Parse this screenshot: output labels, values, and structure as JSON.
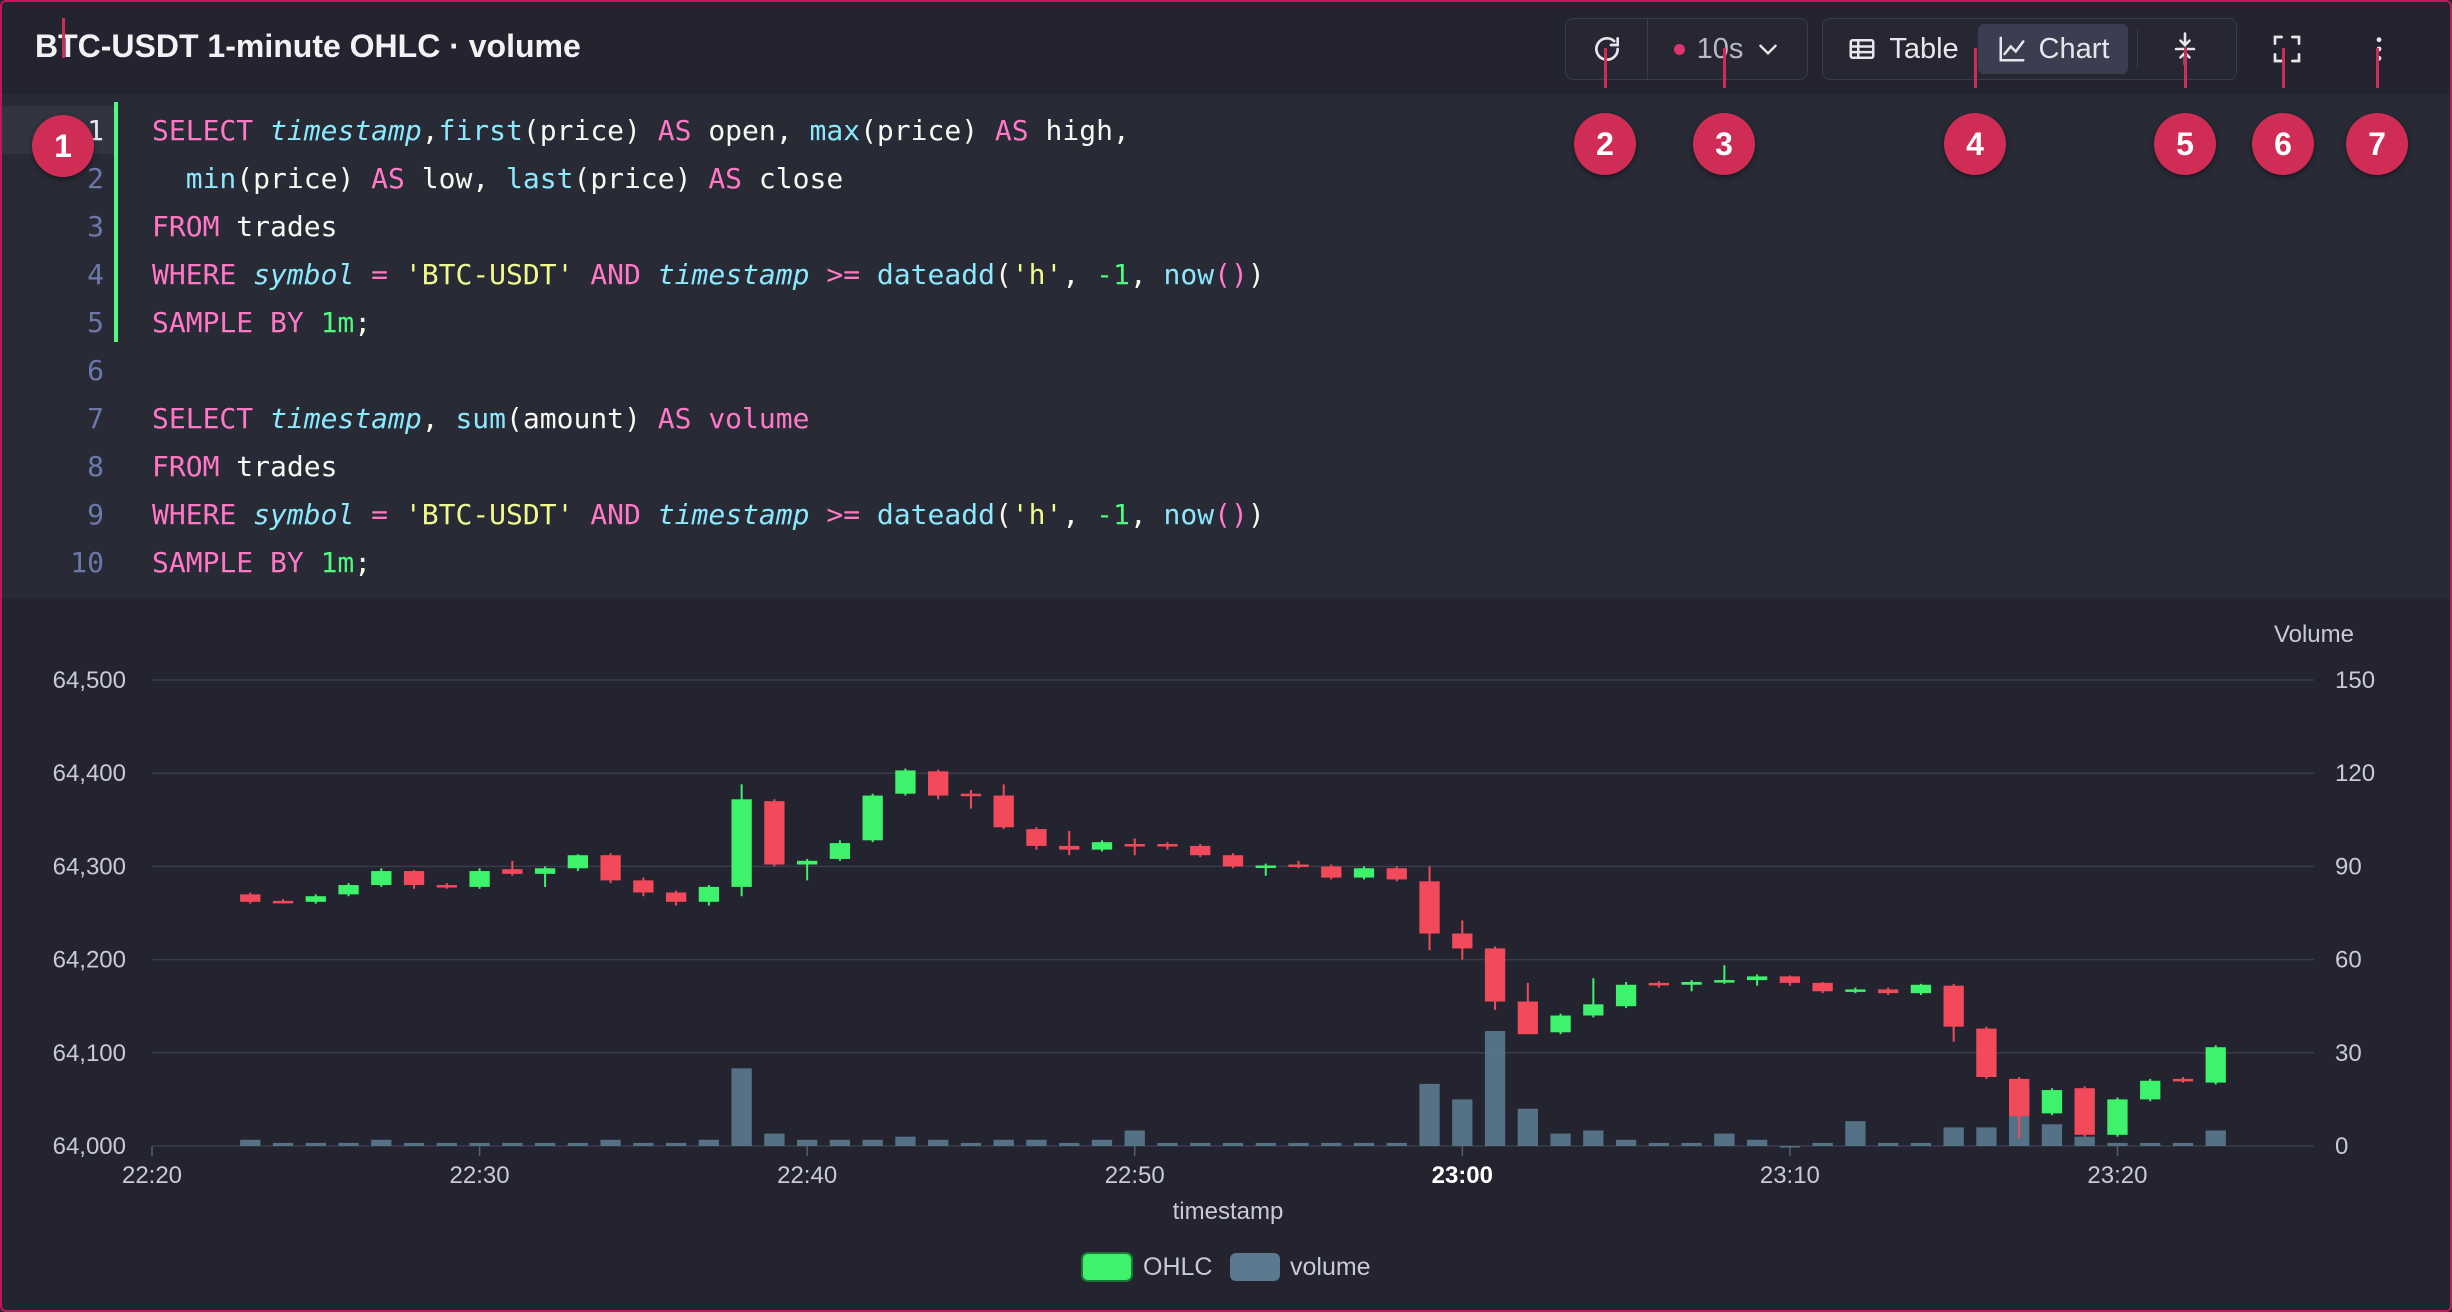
{
  "header": {
    "title": "BTC-USDT 1-minute OHLC · volume",
    "refresh_icon": "refresh-icon",
    "interval_label": "10s",
    "interval_icon": "chevron-down-icon",
    "table_label": "Table",
    "chart_label": "Chart",
    "resize_icon": "vertical-resize-icon",
    "fullscreen_icon": "fullscreen-icon",
    "more_icon": "more-vertical-icon"
  },
  "editor": {
    "active_line": 1,
    "changed_lines": [
      1,
      2,
      3,
      4,
      5
    ],
    "lines": [
      {
        "num": "1",
        "tokens": [
          [
            "kw",
            "SELECT "
          ],
          [
            "id",
            "timestamp"
          ],
          [
            "",
            ","
          ],
          [
            "fn",
            "first"
          ],
          [
            "",
            "(price) "
          ],
          [
            "kw",
            "AS"
          ],
          [
            "",
            " open, "
          ],
          [
            "fn",
            "max"
          ],
          [
            "",
            "(price) "
          ],
          [
            "kw",
            "AS"
          ],
          [
            "",
            " high,"
          ]
        ]
      },
      {
        "num": "2",
        "tokens": [
          [
            "",
            "  "
          ],
          [
            "fn",
            "min"
          ],
          [
            "",
            "(price) "
          ],
          [
            "kw",
            "AS"
          ],
          [
            "",
            " low, "
          ],
          [
            "fn",
            "last"
          ],
          [
            "",
            "(price) "
          ],
          [
            "kw",
            "AS"
          ],
          [
            "",
            " close"
          ]
        ]
      },
      {
        "num": "3",
        "tokens": [
          [
            "kw",
            "FROM"
          ],
          [
            "",
            " trades"
          ]
        ]
      },
      {
        "num": "4",
        "tokens": [
          [
            "kw",
            "WHERE "
          ],
          [
            "id",
            "symbol"
          ],
          [
            "",
            " "
          ],
          [
            "kw",
            "="
          ],
          [
            "",
            " "
          ],
          [
            "str",
            "'BTC-USDT'"
          ],
          [
            "",
            " "
          ],
          [
            "kw",
            "AND"
          ],
          [
            "",
            " "
          ],
          [
            "id",
            "timestamp"
          ],
          [
            "",
            " "
          ],
          [
            "kw",
            ">="
          ],
          [
            "",
            " "
          ],
          [
            "fn",
            "dateadd"
          ],
          [
            "",
            "("
          ],
          [
            "str",
            "'h'"
          ],
          [
            "",
            ", "
          ],
          [
            "num",
            "-1"
          ],
          [
            "",
            ", "
          ],
          [
            "fn",
            "now"
          ],
          [
            "pn",
            "()"
          ],
          [
            "",
            ")"
          ]
        ]
      },
      {
        "num": "5",
        "tokens": [
          [
            "kw",
            "SAMPLE BY "
          ],
          [
            "num",
            "1m"
          ],
          [
            "",
            ";"
          ]
        ]
      },
      {
        "num": "6",
        "tokens": []
      },
      {
        "num": "7",
        "tokens": [
          [
            "kw",
            "SELECT "
          ],
          [
            "id",
            "timestamp"
          ],
          [
            "",
            ", "
          ],
          [
            "fn",
            "sum"
          ],
          [
            "",
            "(amount) "
          ],
          [
            "kw",
            "AS volume"
          ]
        ]
      },
      {
        "num": "8",
        "tokens": [
          [
            "kw",
            "FROM"
          ],
          [
            "",
            " trades"
          ]
        ]
      },
      {
        "num": "9",
        "tokens": [
          [
            "kw",
            "WHERE "
          ],
          [
            "id",
            "symbol"
          ],
          [
            "",
            " "
          ],
          [
            "kw",
            "="
          ],
          [
            "",
            " "
          ],
          [
            "str",
            "'BTC-USDT'"
          ],
          [
            "",
            " "
          ],
          [
            "kw",
            "AND"
          ],
          [
            "",
            " "
          ],
          [
            "id",
            "timestamp"
          ],
          [
            "",
            " "
          ],
          [
            "kw",
            ">="
          ],
          [
            "",
            " "
          ],
          [
            "fn",
            "dateadd"
          ],
          [
            "",
            "("
          ],
          [
            "str",
            "'h'"
          ],
          [
            "",
            ", "
          ],
          [
            "num",
            "-1"
          ],
          [
            "",
            ", "
          ],
          [
            "fn",
            "now"
          ],
          [
            "pn",
            "()"
          ],
          [
            "",
            ")"
          ]
        ]
      },
      {
        "num": "10",
        "tokens": [
          [
            "kw",
            "SAMPLE BY "
          ],
          [
            "num",
            "1m"
          ],
          [
            "",
            ";"
          ]
        ]
      }
    ]
  },
  "colors": {
    "up": "#3ef26c",
    "down": "#f24a5a",
    "volume": "#5a7a8f",
    "badge": "#cf2d55"
  },
  "chart_data": {
    "type": "candlestick",
    "xlabel": "timestamp",
    "y_left_ticks": [
      "64,000",
      "64,100",
      "64,200",
      "64,300",
      "64,400",
      "64,500"
    ],
    "y_left_range": [
      64000,
      64500
    ],
    "y_right_label": "Volume",
    "y_right_ticks": [
      "0",
      "30",
      "60",
      "90",
      "120",
      "150"
    ],
    "y_right_range": [
      0,
      150
    ],
    "x_ticks": [
      {
        "label": "22:20",
        "min": 0,
        "bold": false
      },
      {
        "label": "22:30",
        "min": 10,
        "bold": false
      },
      {
        "label": "22:40",
        "min": 20,
        "bold": false
      },
      {
        "label": "22:50",
        "min": 30,
        "bold": false
      },
      {
        "label": "23:00",
        "min": 40,
        "bold": true
      },
      {
        "label": "23:10",
        "min": 50,
        "bold": false
      },
      {
        "label": "23:20",
        "min": 60,
        "bold": false
      }
    ],
    "grid": true,
    "legend_position": "bottom-center",
    "series": [
      {
        "name": "OHLC",
        "color": "#3ef26c"
      },
      {
        "name": "volume",
        "color": "#5a7a8f"
      }
    ],
    "ohlc": [
      {
        "t": "22:23",
        "o": 64270,
        "h": 64272,
        "l": 64260,
        "c": 64262
      },
      {
        "t": "22:24",
        "o": 64263,
        "h": 64265,
        "l": 64260,
        "c": 64262
      },
      {
        "t": "22:25",
        "o": 64262,
        "h": 64270,
        "l": 64260,
        "c": 64268
      },
      {
        "t": "22:26",
        "o": 64270,
        "h": 64282,
        "l": 64268,
        "c": 64280
      },
      {
        "t": "22:27",
        "o": 64280,
        "h": 64298,
        "l": 64278,
        "c": 64295
      },
      {
        "t": "22:28",
        "o": 64295,
        "h": 64296,
        "l": 64276,
        "c": 64280
      },
      {
        "t": "22:29",
        "o": 64280,
        "h": 64282,
        "l": 64276,
        "c": 64278
      },
      {
        "t": "22:30",
        "o": 64278,
        "h": 64298,
        "l": 64276,
        "c": 64295
      },
      {
        "t": "22:31",
        "o": 64297,
        "h": 64306,
        "l": 64290,
        "c": 64292
      },
      {
        "t": "22:32",
        "o": 64292,
        "h": 64300,
        "l": 64278,
        "c": 64298
      },
      {
        "t": "22:33",
        "o": 64298,
        "h": 64313,
        "l": 64295,
        "c": 64312
      },
      {
        "t": "22:34",
        "o": 64312,
        "h": 64314,
        "l": 64282,
        "c": 64285
      },
      {
        "t": "22:35",
        "o": 64285,
        "h": 64288,
        "l": 64268,
        "c": 64272
      },
      {
        "t": "22:36",
        "o": 64272,
        "h": 64274,
        "l": 64258,
        "c": 64262
      },
      {
        "t": "22:37",
        "o": 64262,
        "h": 64280,
        "l": 64258,
        "c": 64278
      },
      {
        "t": "22:38",
        "o": 64278,
        "h": 64388,
        "l": 64268,
        "c": 64372
      },
      {
        "t": "22:39",
        "o": 64370,
        "h": 64372,
        "l": 64300,
        "c": 64302
      },
      {
        "t": "22:40",
        "o": 64302,
        "h": 64308,
        "l": 64285,
        "c": 64306
      },
      {
        "t": "22:41",
        "o": 64308,
        "h": 64328,
        "l": 64306,
        "c": 64325
      },
      {
        "t": "22:42",
        "o": 64328,
        "h": 64378,
        "l": 64326,
        "c": 64376
      },
      {
        "t": "22:43",
        "o": 64378,
        "h": 64405,
        "l": 64376,
        "c": 64403
      },
      {
        "t": "22:44",
        "o": 64402,
        "h": 64404,
        "l": 64372,
        "c": 64376
      },
      {
        "t": "22:45",
        "o": 64378,
        "h": 64382,
        "l": 64362,
        "c": 64376
      },
      {
        "t": "22:46",
        "o": 64376,
        "h": 64388,
        "l": 64340,
        "c": 64342
      },
      {
        "t": "22:47",
        "o": 64340,
        "h": 64342,
        "l": 64318,
        "c": 64322
      },
      {
        "t": "22:48",
        "o": 64322,
        "h": 64338,
        "l": 64312,
        "c": 64318
      },
      {
        "t": "22:49",
        "o": 64318,
        "h": 64328,
        "l": 64316,
        "c": 64326
      },
      {
        "t": "22:50",
        "o": 64324,
        "h": 64330,
        "l": 64312,
        "c": 64322
      },
      {
        "t": "22:51",
        "o": 64324,
        "h": 64326,
        "l": 64318,
        "c": 64322
      },
      {
        "t": "22:52",
        "o": 64322,
        "h": 64324,
        "l": 64310,
        "c": 64312
      },
      {
        "t": "22:53",
        "o": 64312,
        "h": 64314,
        "l": 64298,
        "c": 64300
      },
      {
        "t": "22:54",
        "o": 64300,
        "h": 64303,
        "l": 64290,
        "c": 64301
      },
      {
        "t": "22:55",
        "o": 64302,
        "h": 64306,
        "l": 64298,
        "c": 64300
      },
      {
        "t": "22:56",
        "o": 64300,
        "h": 64302,
        "l": 64286,
        "c": 64288
      },
      {
        "t": "22:57",
        "o": 64288,
        "h": 64300,
        "l": 64286,
        "c": 64298
      },
      {
        "t": "22:58",
        "o": 64298,
        "h": 64300,
        "l": 64284,
        "c": 64286
      },
      {
        "t": "22:59",
        "o": 64284,
        "h": 64300,
        "l": 64210,
        "c": 64228
      },
      {
        "t": "23:00",
        "o": 64228,
        "h": 64242,
        "l": 64200,
        "c": 64212
      },
      {
        "t": "23:01",
        "o": 64212,
        "h": 64214,
        "l": 64146,
        "c": 64155
      },
      {
        "t": "23:02",
        "o": 64155,
        "h": 64175,
        "l": 64120,
        "c": 64120
      },
      {
        "t": "23:03",
        "o": 64122,
        "h": 64142,
        "l": 64120,
        "c": 64140
      },
      {
        "t": "23:04",
        "o": 64140,
        "h": 64180,
        "l": 64138,
        "c": 64152
      },
      {
        "t": "23:05",
        "o": 64150,
        "h": 64176,
        "l": 64148,
        "c": 64173
      },
      {
        "t": "23:06",
        "o": 64175,
        "h": 64177,
        "l": 64170,
        "c": 64173
      },
      {
        "t": "23:07",
        "o": 64173,
        "h": 64178,
        "l": 64166,
        "c": 64176
      },
      {
        "t": "23:08",
        "o": 64176,
        "h": 64194,
        "l": 64174,
        "c": 64178
      },
      {
        "t": "23:09",
        "o": 64178,
        "h": 64184,
        "l": 64172,
        "c": 64182
      },
      {
        "t": "23:10",
        "o": 64182,
        "h": 64183,
        "l": 64172,
        "c": 64175
      },
      {
        "t": "23:11",
        "o": 64175,
        "h": 64176,
        "l": 64164,
        "c": 64166
      },
      {
        "t": "23:12",
        "o": 64166,
        "h": 64170,
        "l": 64164,
        "c": 64168
      },
      {
        "t": "23:13",
        "o": 64168,
        "h": 64170,
        "l": 64162,
        "c": 64164
      },
      {
        "t": "23:14",
        "o": 64164,
        "h": 64174,
        "l": 64162,
        "c": 64173
      },
      {
        "t": "23:15",
        "o": 64172,
        "h": 64174,
        "l": 64112,
        "c": 64128
      },
      {
        "t": "23:16",
        "o": 64126,
        "h": 64128,
        "l": 64072,
        "c": 64074
      },
      {
        "t": "23:17",
        "o": 64072,
        "h": 64074,
        "l": 64008,
        "c": 64032
      },
      {
        "t": "23:18",
        "o": 64035,
        "h": 64062,
        "l": 64033,
        "c": 64060
      },
      {
        "t": "23:19",
        "o": 64062,
        "h": 64064,
        "l": 64010,
        "c": 64012
      },
      {
        "t": "23:20",
        "o": 64012,
        "h": 64052,
        "l": 64010,
        "c": 64050
      },
      {
        "t": "23:21",
        "o": 64050,
        "h": 64072,
        "l": 64048,
        "c": 64070
      },
      {
        "t": "23:22",
        "o": 64072,
        "h": 64074,
        "l": 64068,
        "c": 64071
      },
      {
        "t": "23:23",
        "o": 64068,
        "h": 64108,
        "l": 64066,
        "c": 64106
      }
    ],
    "volume": [
      {
        "t": "22:23",
        "v": 2
      },
      {
        "t": "22:24",
        "v": 1
      },
      {
        "t": "22:25",
        "v": 1
      },
      {
        "t": "22:26",
        "v": 1
      },
      {
        "t": "22:27",
        "v": 2
      },
      {
        "t": "22:28",
        "v": 1
      },
      {
        "t": "22:29",
        "v": 1
      },
      {
        "t": "22:30",
        "v": 1
      },
      {
        "t": "22:31",
        "v": 1
      },
      {
        "t": "22:32",
        "v": 1
      },
      {
        "t": "22:33",
        "v": 1
      },
      {
        "t": "22:34",
        "v": 2
      },
      {
        "t": "22:35",
        "v": 1
      },
      {
        "t": "22:36",
        "v": 1
      },
      {
        "t": "22:37",
        "v": 2
      },
      {
        "t": "22:38",
        "v": 25
      },
      {
        "t": "22:39",
        "v": 4
      },
      {
        "t": "22:40",
        "v": 2
      },
      {
        "t": "22:41",
        "v": 2
      },
      {
        "t": "22:42",
        "v": 2
      },
      {
        "t": "22:43",
        "v": 3
      },
      {
        "t": "22:44",
        "v": 2
      },
      {
        "t": "22:45",
        "v": 1
      },
      {
        "t": "22:46",
        "v": 2
      },
      {
        "t": "22:47",
        "v": 2
      },
      {
        "t": "22:48",
        "v": 1
      },
      {
        "t": "22:49",
        "v": 2
      },
      {
        "t": "22:50",
        "v": 5
      },
      {
        "t": "22:51",
        "v": 1
      },
      {
        "t": "22:52",
        "v": 1
      },
      {
        "t": "22:53",
        "v": 1
      },
      {
        "t": "22:54",
        "v": 1
      },
      {
        "t": "22:55",
        "v": 1
      },
      {
        "t": "22:56",
        "v": 1
      },
      {
        "t": "22:57",
        "v": 1
      },
      {
        "t": "22:58",
        "v": 1
      },
      {
        "t": "22:59",
        "v": 20
      },
      {
        "t": "23:00",
        "v": 15
      },
      {
        "t": "23:01",
        "v": 37
      },
      {
        "t": "23:02",
        "v": 12
      },
      {
        "t": "23:03",
        "v": 4
      },
      {
        "t": "23:04",
        "v": 5
      },
      {
        "t": "23:05",
        "v": 2
      },
      {
        "t": "23:06",
        "v": 1
      },
      {
        "t": "23:07",
        "v": 1
      },
      {
        "t": "23:08",
        "v": 4
      },
      {
        "t": "23:09",
        "v": 2
      },
      {
        "t": "23:10",
        "v": 0
      },
      {
        "t": "23:11",
        "v": 1
      },
      {
        "t": "23:12",
        "v": 8
      },
      {
        "t": "23:13",
        "v": 1
      },
      {
        "t": "23:14",
        "v": 1
      },
      {
        "t": "23:15",
        "v": 6
      },
      {
        "t": "23:16",
        "v": 6
      },
      {
        "t": "23:17",
        "v": 20
      },
      {
        "t": "23:18",
        "v": 7
      },
      {
        "t": "23:19",
        "v": 3
      },
      {
        "t": "23:20",
        "v": 1
      },
      {
        "t": "23:21",
        "v": 1
      },
      {
        "t": "23:22",
        "v": 1
      },
      {
        "t": "23:23",
        "v": 5
      }
    ]
  },
  "callouts": [
    "1",
    "2",
    "3",
    "4",
    "5",
    "6",
    "7"
  ]
}
